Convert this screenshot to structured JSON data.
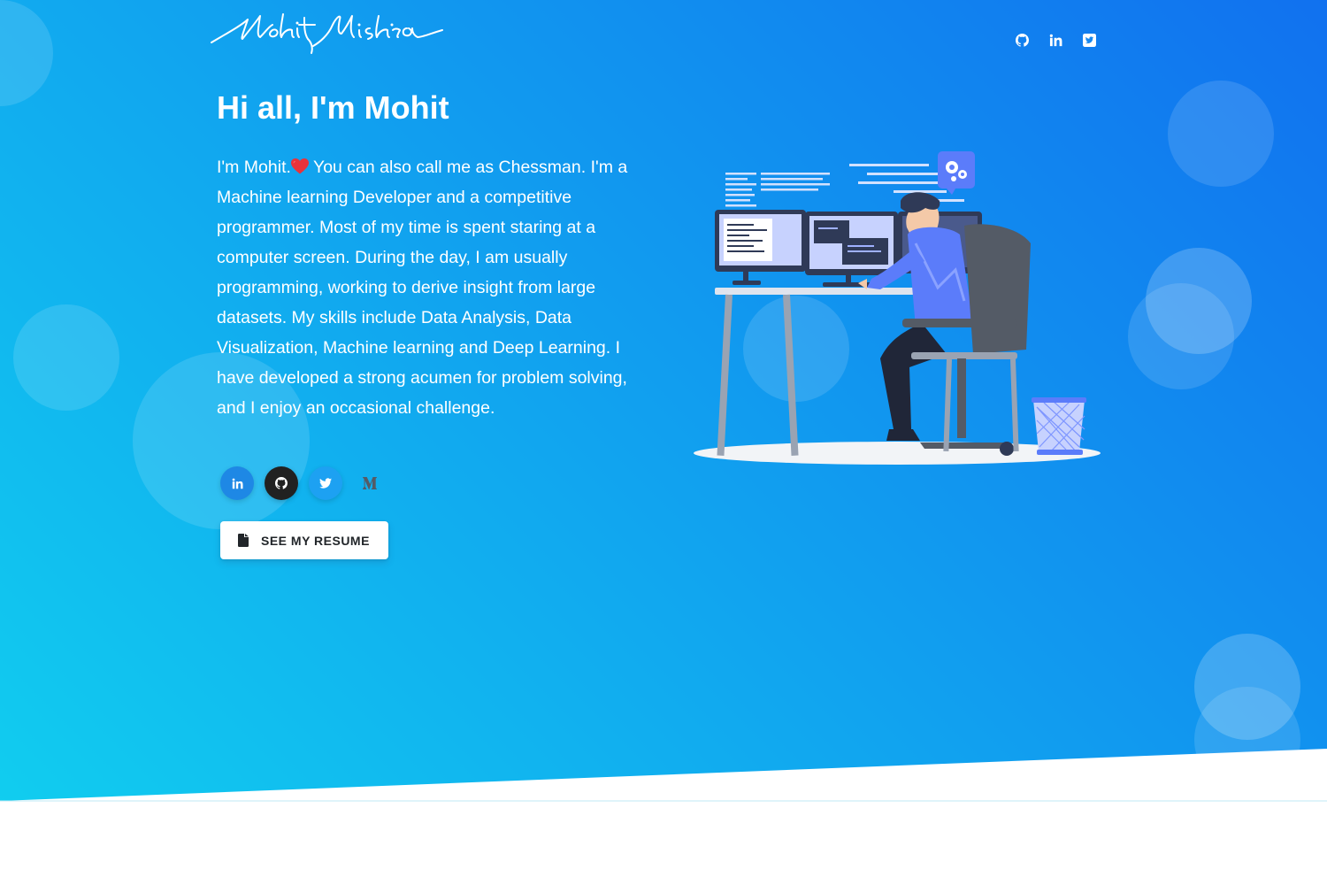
{
  "brand": {
    "logo_text": "Mohit Mishra"
  },
  "nav": {
    "social": [
      {
        "name": "github",
        "icon": "github-icon"
      },
      {
        "name": "linkedin",
        "icon": "linkedin-icon"
      },
      {
        "name": "twitter",
        "icon": "twitter-icon"
      }
    ]
  },
  "hero": {
    "greeting": "Hi all, I'm Mohit",
    "bio_start": "I'm Mohit.",
    "bio_rest": " You can also call me as Chessman. I'm a Machine learning Developer and a competitive programmer. Most of my time is spent staring at a computer screen. During the day, I am usually programming, working to derive insight from large datasets. My skills include Data Analysis, Data Visualization, Machine learning and Deep Learning. I have developed a strong acumen for problem solving, and I enjoy an occasional challenge.",
    "bio_emoji": "heart-emoji",
    "social_buttons": [
      {
        "name": "linkedin",
        "icon": "linkedin-icon"
      },
      {
        "name": "github",
        "icon": "github-icon"
      },
      {
        "name": "twitter",
        "icon": "twitter-icon"
      },
      {
        "name": "medium",
        "icon": "medium-icon"
      }
    ],
    "resume_button": "See My Resume"
  },
  "colors": {
    "gradient_start": "#11cdef",
    "gradient_end": "#1171ef",
    "linkedin": "#1e88e5",
    "github": "#212121",
    "twitter": "#1da1f2"
  }
}
